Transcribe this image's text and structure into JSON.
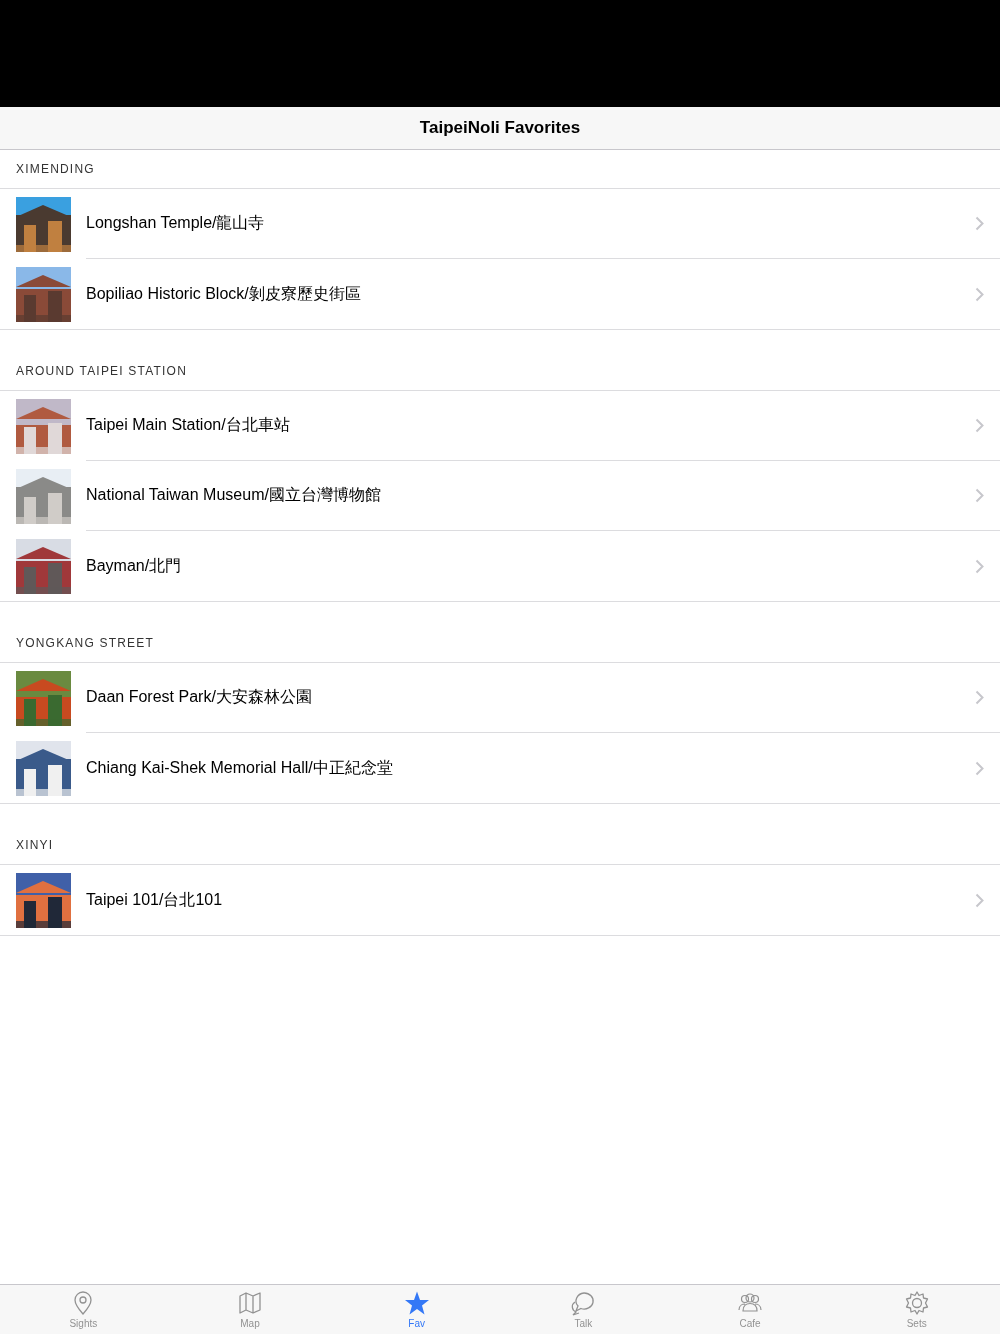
{
  "nav_bar": {
    "title": "TaipeiNoli Favorites"
  },
  "sections": [
    {
      "header": "XIMENDING",
      "items": [
        {
          "kind": "picture",
          "title": "Longshan Temple/龍山寺"
        },
        {
          "kind": "picture",
          "title": "Bopiliao Historic Block/剝皮寮歷史街區"
        }
      ]
    },
    {
      "header": "AROUND TAIPEI STATION",
      "items": [
        {
          "kind": "picture",
          "title": "Taipei Main Station/台北車站"
        },
        {
          "kind": "picture",
          "title": "National Taiwan Museum/國立台灣博物館"
        },
        {
          "kind": "picture",
          "title": "Bayman/北門"
        }
      ]
    },
    {
      "header": "YONGKANG STREET",
      "items": [
        {
          "kind": "picture",
          "title": "Daan Forest Park/大安森林公園"
        },
        {
          "kind": "picture",
          "title": "Chiang Kai-Shek Memorial Hall/中正紀念堂"
        }
      ]
    },
    {
      "header": "XINYI",
      "items": [
        {
          "kind": "picture",
          "title": "Taipei 101/台北101"
        }
      ]
    }
  ],
  "tab_bar": [
    {
      "kind": "pin",
      "label": "Sights",
      "selected": false
    },
    {
      "kind": "map",
      "label": "Map",
      "selected": false
    },
    {
      "kind": "star",
      "label": "Fav",
      "selected": true
    },
    {
      "kind": "talk",
      "label": "Talk",
      "selected": false
    },
    {
      "kind": "people",
      "label": "Cafe",
      "selected": false
    },
    {
      "kind": "gear",
      "label": "Sets",
      "selected": false
    }
  ]
}
